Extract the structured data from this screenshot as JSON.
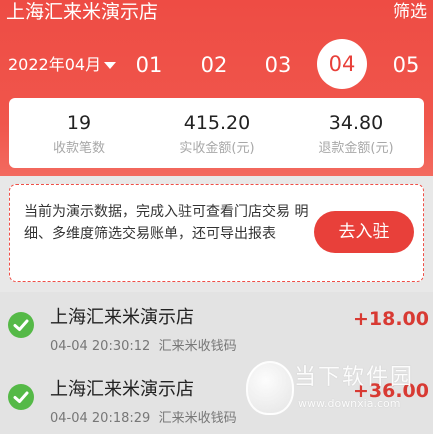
{
  "header": {
    "store_name": "上海汇来米演示店",
    "filter_label": "筛选",
    "month": "2022年04月",
    "days": [
      "01",
      "02",
      "03",
      "04",
      "05"
    ],
    "selected_day": "04",
    "accent_color": "#e8403a"
  },
  "stats": [
    {
      "value": "19",
      "label": "收款笔数"
    },
    {
      "value": "415.20",
      "label": "实收金额(元)"
    },
    {
      "value": "34.80",
      "label": "退款金额(元)"
    }
  ],
  "notice": {
    "text": "当前为演示数据，完成入驻可查看门店交易 明细、多维度筛选交易账单，还可导出报表",
    "button_label": "去入驻"
  },
  "transactions": [
    {
      "name": "上海汇来米演示店",
      "time": "04-04 20:30:12",
      "channel": "汇来米收钱码",
      "amount": "+18.00",
      "icon": "wechat-pay-icon"
    },
    {
      "name": "上海汇来米演示店",
      "time": "04-04 20:18:29",
      "channel": "汇来米收钱码",
      "amount": "+36.00",
      "icon": "wechat-pay-icon"
    }
  ],
  "watermark": {
    "text": "当下软件园",
    "url": "www.downxia.com"
  }
}
